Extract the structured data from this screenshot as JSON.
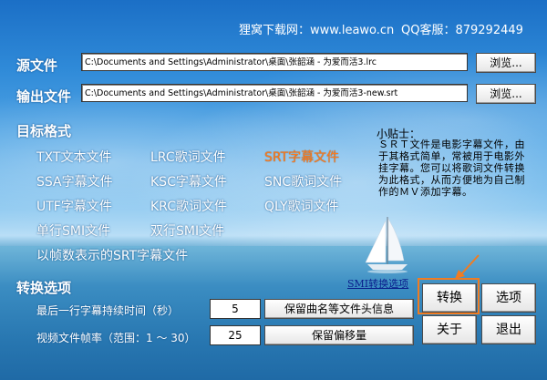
{
  "header": {
    "site": "狸窝下载网：www.leawo.cn",
    "qq": "QQ客服：879292449"
  },
  "source": {
    "label": "源文件",
    "path": "C:\\Documents and Settings\\Administrator\\桌面\\张韶涵 - 为爱而活3.lrc",
    "browse": "浏览..."
  },
  "output": {
    "label": "输出文件",
    "path": "C:\\Documents and Settings\\Administrator\\桌面\\张韶涵 - 为爱而活3-new.srt",
    "browse": "浏览..."
  },
  "target": {
    "label": "目标格式",
    "formats": [
      "TXT文本文件",
      "LRC歌词文件",
      "SRT字幕文件",
      "SSA字幕文件",
      "KSC字幕文件",
      "SNC歌词文件",
      "UTF字幕文件",
      "KRC歌词文件",
      "QLY歌词文件",
      "单行SMI文件",
      "双行SMI文件",
      "以帧数表示的SRT字幕文件"
    ],
    "selected": "SRT字幕文件"
  },
  "tip": {
    "title": "小贴士：",
    "text": "ＳＲＴ文件是电影字幕文件，由于其格式简单，常被用于电影外挂字幕。您可以将歌词文件转换为此格式，从而方便地为自己制作的ＭＶ添加字幕。"
  },
  "convert_options": {
    "label": "转换选项",
    "smi_link": "SMI转换选项",
    "last_line_label": "最后一行字幕持续时间（秒）",
    "last_line_value": "5",
    "framerate_label": "视频文件帧率（范围：1 ～ 30）",
    "framerate_value": "25",
    "keep_header": "保留曲名等文件头信息",
    "keep_offset": "保留偏移量"
  },
  "actions": {
    "convert": "转换",
    "options": "选项",
    "about": "关于",
    "exit": "退出"
  },
  "colors": {
    "selected_format": "#ff7a1a",
    "annotation_arrow": "#f07c22"
  }
}
